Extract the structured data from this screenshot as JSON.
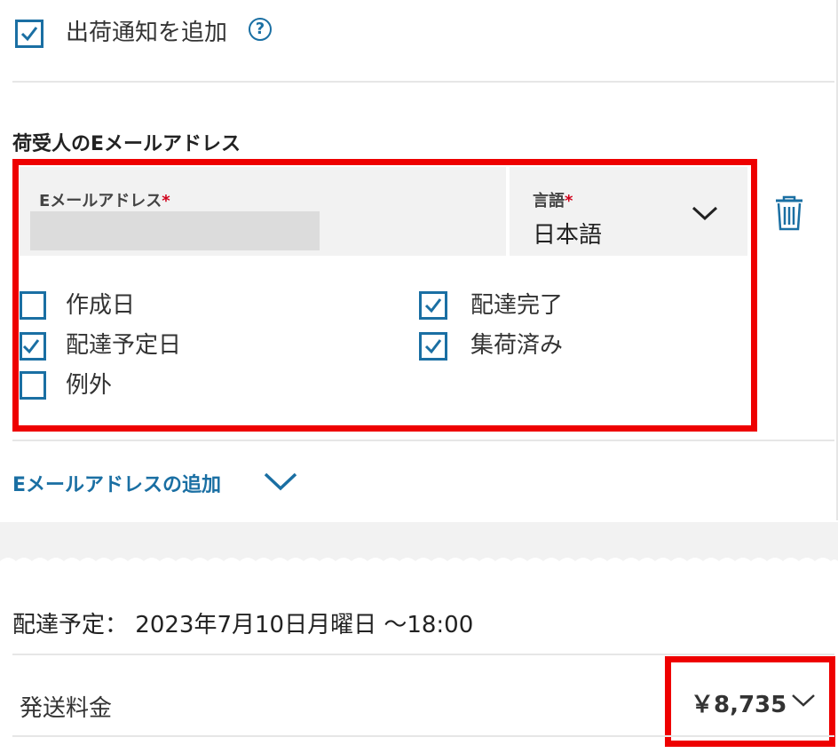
{
  "shipment_notification": {
    "checkbox_checked": true,
    "label": "出荷通知を追加",
    "help_symbol": "?"
  },
  "recipient_email": {
    "section_title": "荷受人のEメールアドレス",
    "email_label": "Eメールアドレス",
    "required_mark": "*",
    "email_value": "",
    "language_label": "言語",
    "language_value": "日本語",
    "delete_icon": "trash-icon",
    "options": [
      {
        "label": "作成日",
        "checked": false
      },
      {
        "label": "配達予定日",
        "checked": true
      },
      {
        "label": "例外",
        "checked": false
      },
      {
        "label": "配達完了",
        "checked": true
      },
      {
        "label": "集荷済み",
        "checked": true
      }
    ]
  },
  "add_email": {
    "label": "Eメールアドレスの追加",
    "icon": "chevron-down-icon"
  },
  "delivery": {
    "label": "配達予定：",
    "value": "2023年7月10日月曜日 〜18:00"
  },
  "shipping_fee": {
    "label": "発送料金",
    "amount": "￥8,735"
  },
  "colors": {
    "accent": "#1a6fa3",
    "highlight": "#ee0000",
    "required": "#d0021b",
    "field_bg": "#f2f2f2"
  }
}
